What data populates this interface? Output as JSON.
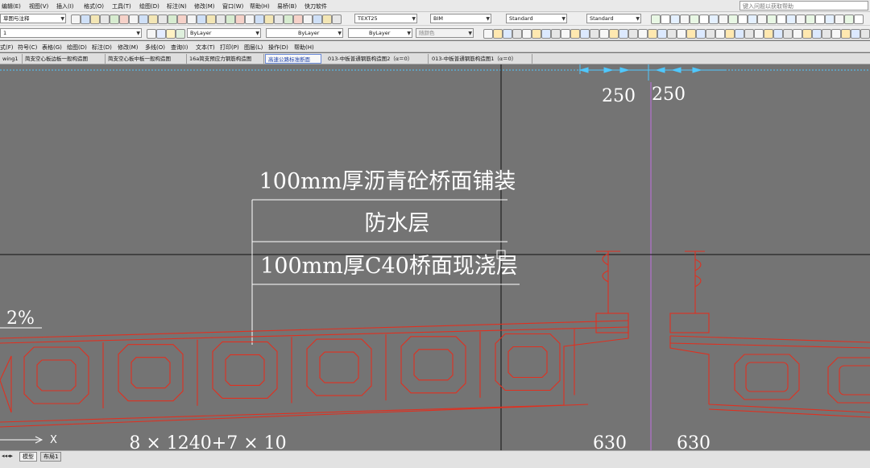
{
  "menu": {
    "items": [
      "编辑(E)",
      "视图(V)",
      "插入(I)",
      "格式(O)",
      "工具(T)",
      "绘图(D)",
      "标注(N)",
      "修改(M)",
      "窗口(W)",
      "帮助(H)",
      "易桥(B)",
      "快刀软件"
    ],
    "help_search_placeholder": "键入问题以获取帮助"
  },
  "toolbar1": {
    "workspace": "草图与注释",
    "text_style": "TEXT25",
    "dim_style": "BIM",
    "table_style": "Standard",
    "multileader_style": "Standard"
  },
  "toolbar2": {
    "layer": "1",
    "color": "ByLayer",
    "linetype": "ByLayer",
    "lineweight": "ByLayer",
    "plot_style": "随颜色"
  },
  "menu2": {
    "items": [
      "式(F)",
      "符号(C)",
      "表格(G)",
      "绘图(D)",
      "标注(D)",
      "修改(M)",
      "多线(O)",
      "查询(I)",
      "文本(T)",
      "打印(P)",
      "图层(L)",
      "操作(D)",
      "帮助(H)"
    ]
  },
  "file_tabs": [
    {
      "label": "wing1",
      "active": false
    },
    {
      "label": "简支空心板边板一般构造图",
      "active": false
    },
    {
      "label": "简支空心板中板一般构造图",
      "active": false
    },
    {
      "label": "16a简支预应力钢筋构造图",
      "active": false
    },
    {
      "label": "高速公路标准断面",
      "active": true
    },
    {
      "label": "013-中板普通钢筋构造图2（α＝0）",
      "active": false
    },
    {
      "label": "013-中板普通钢筋构造图1（α＝0）",
      "active": false
    }
  ],
  "drawing": {
    "layer_labels": [
      "100mm厚沥青砼桥面铺装",
      "防水层",
      "100mm厚C40桥面现浇层"
    ],
    "dim_top_left": "250",
    "dim_top_right": "250",
    "dim_bottom_left": "8 × 1240+7 × 10",
    "dim_bottom_mid": "630",
    "dim_bottom_right": "630",
    "slope": "2%",
    "ucs_axis": "X",
    "colors": {
      "background": "#747474",
      "structure": "#e03020",
      "text": "#ffffff",
      "crosshair": "#101010",
      "center_line": "#c070e0",
      "dimension": "#4fc8ff"
    }
  },
  "layout_tabs": [
    "模型",
    "布局1"
  ]
}
